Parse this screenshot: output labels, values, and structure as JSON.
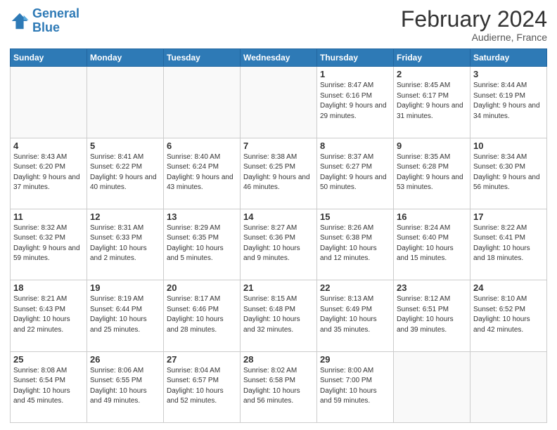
{
  "header": {
    "logo_line1": "General",
    "logo_line2": "Blue",
    "main_title": "February 2024",
    "subtitle": "Audierne, France"
  },
  "days_of_week": [
    "Sunday",
    "Monday",
    "Tuesday",
    "Wednesday",
    "Thursday",
    "Friday",
    "Saturday"
  ],
  "weeks": [
    [
      {
        "day": "",
        "info": ""
      },
      {
        "day": "",
        "info": ""
      },
      {
        "day": "",
        "info": ""
      },
      {
        "day": "",
        "info": ""
      },
      {
        "day": "1",
        "info": "Sunrise: 8:47 AM\nSunset: 6:16 PM\nDaylight: 9 hours\nand 29 minutes."
      },
      {
        "day": "2",
        "info": "Sunrise: 8:45 AM\nSunset: 6:17 PM\nDaylight: 9 hours\nand 31 minutes."
      },
      {
        "day": "3",
        "info": "Sunrise: 8:44 AM\nSunset: 6:19 PM\nDaylight: 9 hours\nand 34 minutes."
      }
    ],
    [
      {
        "day": "4",
        "info": "Sunrise: 8:43 AM\nSunset: 6:20 PM\nDaylight: 9 hours\nand 37 minutes."
      },
      {
        "day": "5",
        "info": "Sunrise: 8:41 AM\nSunset: 6:22 PM\nDaylight: 9 hours\nand 40 minutes."
      },
      {
        "day": "6",
        "info": "Sunrise: 8:40 AM\nSunset: 6:24 PM\nDaylight: 9 hours\nand 43 minutes."
      },
      {
        "day": "7",
        "info": "Sunrise: 8:38 AM\nSunset: 6:25 PM\nDaylight: 9 hours\nand 46 minutes."
      },
      {
        "day": "8",
        "info": "Sunrise: 8:37 AM\nSunset: 6:27 PM\nDaylight: 9 hours\nand 50 minutes."
      },
      {
        "day": "9",
        "info": "Sunrise: 8:35 AM\nSunset: 6:28 PM\nDaylight: 9 hours\nand 53 minutes."
      },
      {
        "day": "10",
        "info": "Sunrise: 8:34 AM\nSunset: 6:30 PM\nDaylight: 9 hours\nand 56 minutes."
      }
    ],
    [
      {
        "day": "11",
        "info": "Sunrise: 8:32 AM\nSunset: 6:32 PM\nDaylight: 9 hours\nand 59 minutes."
      },
      {
        "day": "12",
        "info": "Sunrise: 8:31 AM\nSunset: 6:33 PM\nDaylight: 10 hours\nand 2 minutes."
      },
      {
        "day": "13",
        "info": "Sunrise: 8:29 AM\nSunset: 6:35 PM\nDaylight: 10 hours\nand 5 minutes."
      },
      {
        "day": "14",
        "info": "Sunrise: 8:27 AM\nSunset: 6:36 PM\nDaylight: 10 hours\nand 9 minutes."
      },
      {
        "day": "15",
        "info": "Sunrise: 8:26 AM\nSunset: 6:38 PM\nDaylight: 10 hours\nand 12 minutes."
      },
      {
        "day": "16",
        "info": "Sunrise: 8:24 AM\nSunset: 6:40 PM\nDaylight: 10 hours\nand 15 minutes."
      },
      {
        "day": "17",
        "info": "Sunrise: 8:22 AM\nSunset: 6:41 PM\nDaylight: 10 hours\nand 18 minutes."
      }
    ],
    [
      {
        "day": "18",
        "info": "Sunrise: 8:21 AM\nSunset: 6:43 PM\nDaylight: 10 hours\nand 22 minutes."
      },
      {
        "day": "19",
        "info": "Sunrise: 8:19 AM\nSunset: 6:44 PM\nDaylight: 10 hours\nand 25 minutes."
      },
      {
        "day": "20",
        "info": "Sunrise: 8:17 AM\nSunset: 6:46 PM\nDaylight: 10 hours\nand 28 minutes."
      },
      {
        "day": "21",
        "info": "Sunrise: 8:15 AM\nSunset: 6:48 PM\nDaylight: 10 hours\nand 32 minutes."
      },
      {
        "day": "22",
        "info": "Sunrise: 8:13 AM\nSunset: 6:49 PM\nDaylight: 10 hours\nand 35 minutes."
      },
      {
        "day": "23",
        "info": "Sunrise: 8:12 AM\nSunset: 6:51 PM\nDaylight: 10 hours\nand 39 minutes."
      },
      {
        "day": "24",
        "info": "Sunrise: 8:10 AM\nSunset: 6:52 PM\nDaylight: 10 hours\nand 42 minutes."
      }
    ],
    [
      {
        "day": "25",
        "info": "Sunrise: 8:08 AM\nSunset: 6:54 PM\nDaylight: 10 hours\nand 45 minutes."
      },
      {
        "day": "26",
        "info": "Sunrise: 8:06 AM\nSunset: 6:55 PM\nDaylight: 10 hours\nand 49 minutes."
      },
      {
        "day": "27",
        "info": "Sunrise: 8:04 AM\nSunset: 6:57 PM\nDaylight: 10 hours\nand 52 minutes."
      },
      {
        "day": "28",
        "info": "Sunrise: 8:02 AM\nSunset: 6:58 PM\nDaylight: 10 hours\nand 56 minutes."
      },
      {
        "day": "29",
        "info": "Sunrise: 8:00 AM\nSunset: 7:00 PM\nDaylight: 10 hours\nand 59 minutes."
      },
      {
        "day": "",
        "info": ""
      },
      {
        "day": "",
        "info": ""
      }
    ]
  ]
}
